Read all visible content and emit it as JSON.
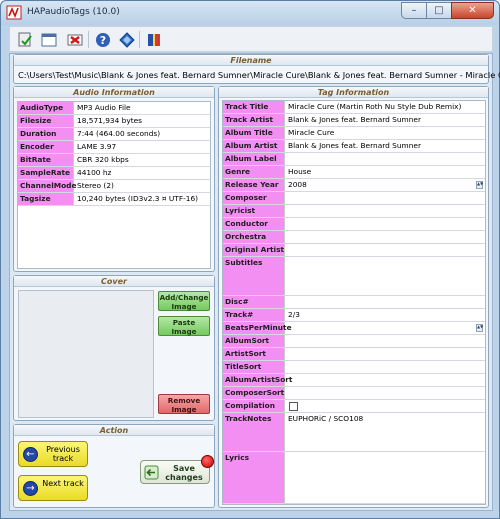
{
  "window": {
    "title": "HAPaudioTags (10.0)"
  },
  "toolbar": {
    "buttons": [
      "save-check-icon",
      "window-icon",
      "delete-tags-icon",
      "help-icon",
      "settings-diamond-icon",
      "book-icon"
    ]
  },
  "filename": {
    "title": "Filename",
    "value": "C:\\Users\\Test\\Music\\Blank & Jones feat. Bernard Sumner\\Miracle Cure\\Blank & Jones feat. Bernard Sumner - Miracle Cure"
  },
  "audio": {
    "title": "Audio Information",
    "rows": [
      {
        "label": "AudioType",
        "value": "MP3 Audio File"
      },
      {
        "label": "Filesize",
        "value": "18,571,934 bytes"
      },
      {
        "label": "Duration",
        "value": "7:44 (464.00 seconds)"
      },
      {
        "label": "Encoder",
        "value": "LAME 3.97"
      },
      {
        "label": "BitRate",
        "value": "CBR 320 kbps"
      },
      {
        "label": "SampleRate",
        "value": "44100 hz"
      },
      {
        "label": "ChannelMode",
        "value": "Stereo (2)"
      },
      {
        "label": "Tagsize",
        "value": "10,240 bytes (ID3v2.3 ¤ UTF-16)"
      }
    ]
  },
  "cover": {
    "title": "Cover",
    "add_label": "Add/Change Image",
    "paste_label": "Paste Image",
    "remove_label": "Remove Image"
  },
  "action": {
    "title": "Action",
    "previous_label": "Previous track",
    "next_label": "Next track",
    "save_label": "Save changes"
  },
  "tags": {
    "title": "Tag Information",
    "rows": [
      {
        "label": "Track Title",
        "value": "Miracle Cure (Martin Roth Nu Style Dub Remix)"
      },
      {
        "label": "Track Artist",
        "value": "Blank & Jones feat. Bernard Sumner"
      },
      {
        "label": "Album Title",
        "value": "Miracle Cure"
      },
      {
        "label": "Album Artist",
        "value": "Blank & Jones feat. Bernard Sumner"
      },
      {
        "label": "Album Label",
        "value": ""
      },
      {
        "label": "Genre",
        "value": "House"
      },
      {
        "label": "Release Year",
        "value": "2008"
      },
      {
        "label": "Composer",
        "value": ""
      },
      {
        "label": "Lyricist",
        "value": ""
      },
      {
        "label": "Conductor",
        "value": ""
      },
      {
        "label": "Orchestra",
        "value": ""
      },
      {
        "label": "Original Artist",
        "value": ""
      },
      {
        "label": "Subtitles",
        "value": ""
      },
      {
        "label": "Disc#",
        "value": ""
      },
      {
        "label": "Track#",
        "value": "2/3"
      },
      {
        "label": "BeatsPerMinute",
        "value": ""
      },
      {
        "label": "AlbumSort",
        "value": ""
      },
      {
        "label": "ArtistSort",
        "value": ""
      },
      {
        "label": "TitleSort",
        "value": ""
      },
      {
        "label": "AlbumArtistSort",
        "value": ""
      },
      {
        "label": "ComposerSort",
        "value": ""
      },
      {
        "label": "Compilation",
        "value": ""
      },
      {
        "label": "TrackNotes",
        "value": "EUPHORiC / SCO108"
      },
      {
        "label": "Lyrics",
        "value": ""
      }
    ]
  },
  "colors": {
    "label_bg": "#f38ef3",
    "accent_green": "#74c95f",
    "accent_yellow": "#e9db24",
    "accent_red": "#e06969"
  }
}
